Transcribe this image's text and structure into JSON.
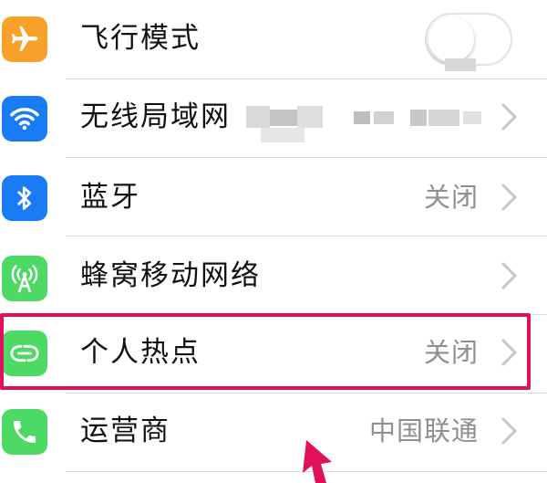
{
  "settings": {
    "items": [
      {
        "label": "飞行模式",
        "icon": "airplane-icon",
        "color": "#f7a02a"
      },
      {
        "label": "无线局域网",
        "icon": "wifi-icon",
        "color": "#1a7cf5"
      },
      {
        "label": "蓝牙",
        "value": "关闭",
        "icon": "bluetooth-icon",
        "color": "#1a7cf5"
      },
      {
        "label": "蜂窝移动网络",
        "icon": "cellular-antenna-icon",
        "color": "#4cd964"
      },
      {
        "label": "个人热点",
        "value": "关闭",
        "icon": "hotspot-icon",
        "color": "#4cd964"
      },
      {
        "label": "运营商",
        "value": "中国联通",
        "icon": "phone-icon",
        "color": "#4cd964"
      }
    ]
  },
  "colors": {
    "highlight": "#e0105a",
    "value_text": "#8e8e93"
  }
}
